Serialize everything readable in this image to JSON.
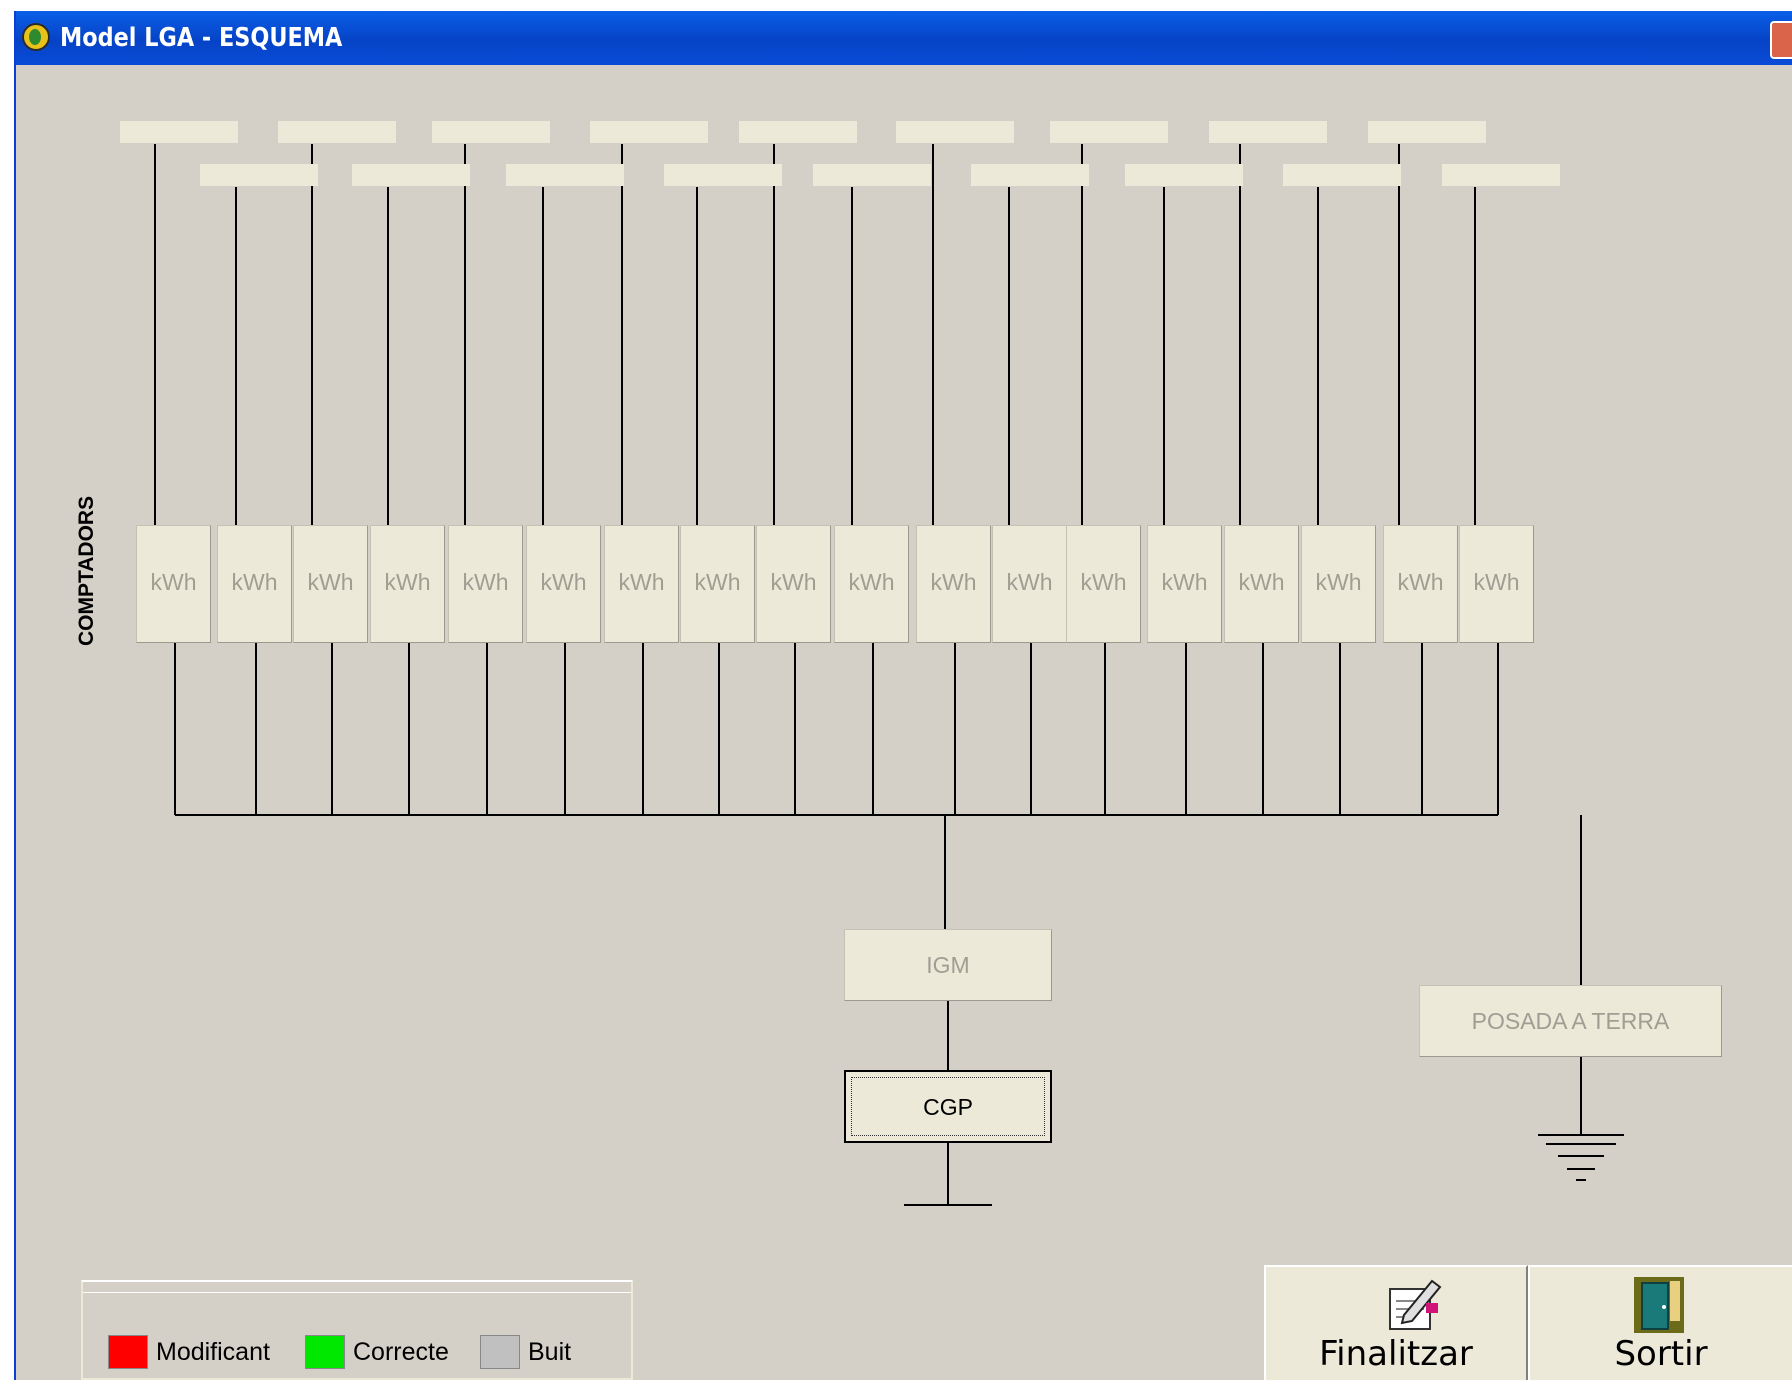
{
  "window": {
    "title": "Model LGA - ESQUEMA"
  },
  "diagram": {
    "section_label": "COMPTADORS",
    "meters": [
      "kWh",
      "kWh",
      "kWh",
      "kWh",
      "kWh",
      "kWh",
      "kWh",
      "kWh",
      "kWh",
      "kWh",
      "kWh",
      "kWh",
      "kWh",
      "kWh",
      "kWh",
      "kWh",
      "kWh",
      "kWh"
    ],
    "top_label_boxes": 18,
    "igm_label": "IGM",
    "cgp_label": "CGP",
    "ground_label": "POSADA A TERRA"
  },
  "legend": {
    "items": [
      {
        "label": "Modificant",
        "color": "#ff0000"
      },
      {
        "label": "Correcte",
        "color": "#00e800"
      },
      {
        "label": "Buit",
        "color": "#c0c0c0"
      }
    ]
  },
  "buttons": {
    "finalize_label": "Finalitzar",
    "exit_label": "Sortir"
  },
  "icons": [
    "app-icon",
    "close-icon",
    "pencil-document-icon",
    "exit-door-icon",
    "ground-symbol-icon"
  ]
}
